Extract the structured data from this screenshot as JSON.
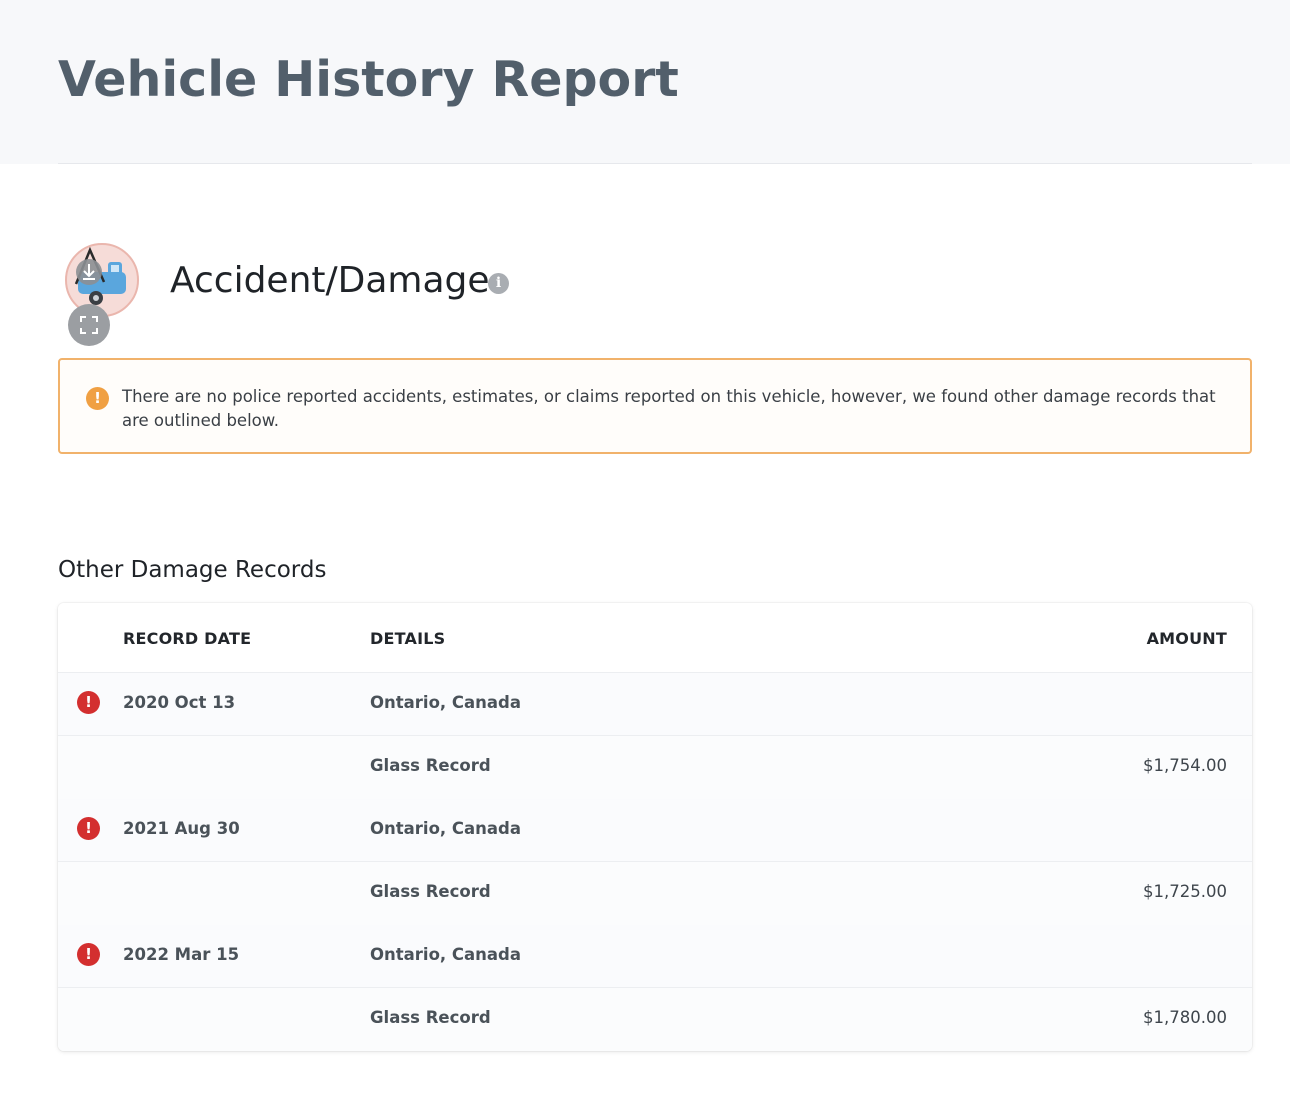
{
  "header": {
    "title": "Vehicle History Report"
  },
  "section": {
    "title": "Accident/Damage",
    "icon": "tow-truck-icon",
    "info_glyph": "i"
  },
  "alert": {
    "glyph": "!",
    "message": "There are no police reported accidents, estimates, or claims reported on this vehicle, however, we found other damage records that are outlined below."
  },
  "records": {
    "title": "Other Damage Records",
    "columns": {
      "date": "RECORD DATE",
      "details": "DETAILS",
      "amount": "AMOUNT"
    },
    "error_glyph": "!",
    "rows": [
      {
        "date": "2020 Oct 13",
        "location": "Ontario, Canada",
        "type": "Glass Record",
        "amount": "$1,754.00"
      },
      {
        "date": "2021 Aug 30",
        "location": "Ontario, Canada",
        "type": "Glass Record",
        "amount": "$1,725.00"
      },
      {
        "date": "2022 Mar 15",
        "location": "Ontario, Canada",
        "type": "Glass Record",
        "amount": "$1,780.00"
      }
    ]
  },
  "colors": {
    "warning": "#f0a043",
    "error": "#d32f2f",
    "title": "#525f6b"
  }
}
